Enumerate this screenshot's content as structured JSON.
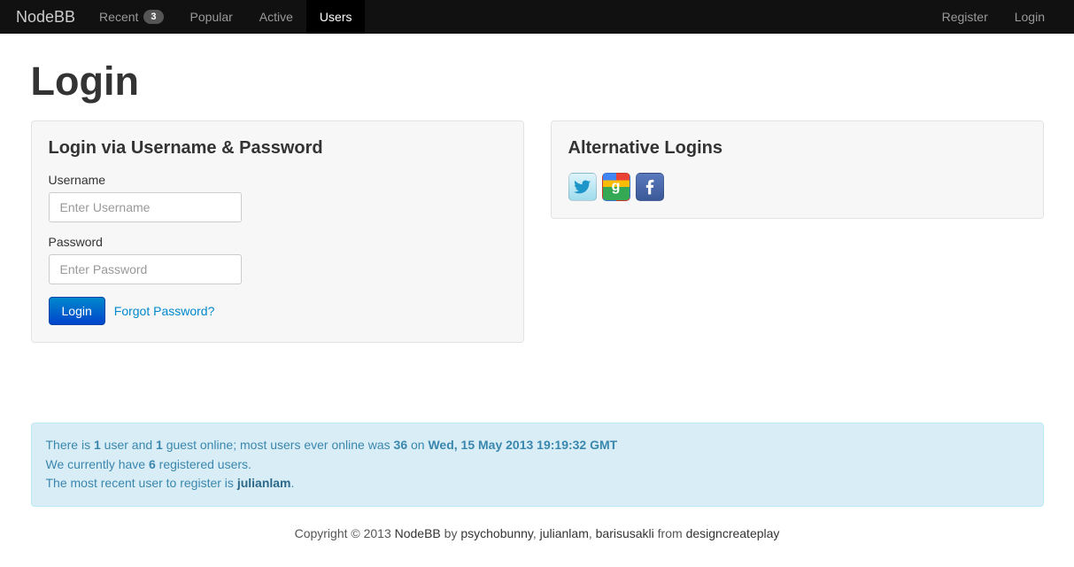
{
  "nav": {
    "brand": "NodeBB",
    "left": [
      {
        "label": "Recent",
        "badge": "3",
        "active": false
      },
      {
        "label": "Popular",
        "badge": null,
        "active": false
      },
      {
        "label": "Active",
        "badge": null,
        "active": false
      },
      {
        "label": "Users",
        "badge": null,
        "active": true
      }
    ],
    "right": [
      {
        "label": "Register"
      },
      {
        "label": "Login"
      }
    ]
  },
  "page": {
    "title": "Login"
  },
  "loginPanel": {
    "heading": "Login via Username & Password",
    "usernameLabel": "Username",
    "usernamePlaceholder": "Enter Username",
    "passwordLabel": "Password",
    "passwordPlaceholder": "Enter Password",
    "loginButton": "Login",
    "forgotLink": "Forgot Password?"
  },
  "altPanel": {
    "heading": "Alternative Logins",
    "providers": [
      "twitter",
      "google",
      "facebook"
    ]
  },
  "stats": {
    "line1_a": "There is ",
    "usersOnline": "1",
    "line1_b": " user and ",
    "guestsOnline": "1",
    "line1_c": " guest online; most users ever online was ",
    "maxOnline": "36",
    "line1_d": " on ",
    "maxDate": "Wed, 15 May 2013 19:19:32 GMT",
    "line2_a": "We currently have ",
    "registered": "6",
    "line2_b": " registered users.",
    "line3_a": "The most recent user to register is ",
    "lastUser": "julianlam",
    "line3_b": "."
  },
  "footer": {
    "copyright": "Copyright © 2013 ",
    "product": "NodeBB",
    "by": " by ",
    "a1": "psychobunny",
    "s1": ", ",
    "a2": "julianlam",
    "s2": ", ",
    "a3": "barisusakli",
    "from": " from ",
    "org": "designcreateplay"
  }
}
